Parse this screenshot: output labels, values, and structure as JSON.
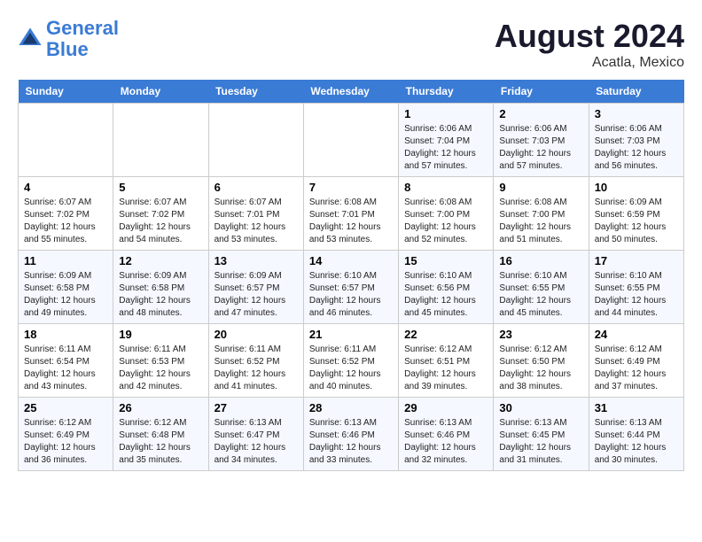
{
  "header": {
    "logo_line1": "General",
    "logo_line2": "Blue",
    "month_year": "August 2024",
    "location": "Acatla, Mexico"
  },
  "days_of_week": [
    "Sunday",
    "Monday",
    "Tuesday",
    "Wednesday",
    "Thursday",
    "Friday",
    "Saturday"
  ],
  "weeks": [
    [
      {
        "day": "",
        "sunrise": "",
        "sunset": "",
        "daylight": ""
      },
      {
        "day": "",
        "sunrise": "",
        "sunset": "",
        "daylight": ""
      },
      {
        "day": "",
        "sunrise": "",
        "sunset": "",
        "daylight": ""
      },
      {
        "day": "",
        "sunrise": "",
        "sunset": "",
        "daylight": ""
      },
      {
        "day": "1",
        "sunrise": "Sunrise: 6:06 AM",
        "sunset": "Sunset: 7:04 PM",
        "daylight": "Daylight: 12 hours and 57 minutes."
      },
      {
        "day": "2",
        "sunrise": "Sunrise: 6:06 AM",
        "sunset": "Sunset: 7:03 PM",
        "daylight": "Daylight: 12 hours and 57 minutes."
      },
      {
        "day": "3",
        "sunrise": "Sunrise: 6:06 AM",
        "sunset": "Sunset: 7:03 PM",
        "daylight": "Daylight: 12 hours and 56 minutes."
      }
    ],
    [
      {
        "day": "4",
        "sunrise": "Sunrise: 6:07 AM",
        "sunset": "Sunset: 7:02 PM",
        "daylight": "Daylight: 12 hours and 55 minutes."
      },
      {
        "day": "5",
        "sunrise": "Sunrise: 6:07 AM",
        "sunset": "Sunset: 7:02 PM",
        "daylight": "Daylight: 12 hours and 54 minutes."
      },
      {
        "day": "6",
        "sunrise": "Sunrise: 6:07 AM",
        "sunset": "Sunset: 7:01 PM",
        "daylight": "Daylight: 12 hours and 53 minutes."
      },
      {
        "day": "7",
        "sunrise": "Sunrise: 6:08 AM",
        "sunset": "Sunset: 7:01 PM",
        "daylight": "Daylight: 12 hours and 53 minutes."
      },
      {
        "day": "8",
        "sunrise": "Sunrise: 6:08 AM",
        "sunset": "Sunset: 7:00 PM",
        "daylight": "Daylight: 12 hours and 52 minutes."
      },
      {
        "day": "9",
        "sunrise": "Sunrise: 6:08 AM",
        "sunset": "Sunset: 7:00 PM",
        "daylight": "Daylight: 12 hours and 51 minutes."
      },
      {
        "day": "10",
        "sunrise": "Sunrise: 6:09 AM",
        "sunset": "Sunset: 6:59 PM",
        "daylight": "Daylight: 12 hours and 50 minutes."
      }
    ],
    [
      {
        "day": "11",
        "sunrise": "Sunrise: 6:09 AM",
        "sunset": "Sunset: 6:58 PM",
        "daylight": "Daylight: 12 hours and 49 minutes."
      },
      {
        "day": "12",
        "sunrise": "Sunrise: 6:09 AM",
        "sunset": "Sunset: 6:58 PM",
        "daylight": "Daylight: 12 hours and 48 minutes."
      },
      {
        "day": "13",
        "sunrise": "Sunrise: 6:09 AM",
        "sunset": "Sunset: 6:57 PM",
        "daylight": "Daylight: 12 hours and 47 minutes."
      },
      {
        "day": "14",
        "sunrise": "Sunrise: 6:10 AM",
        "sunset": "Sunset: 6:57 PM",
        "daylight": "Daylight: 12 hours and 46 minutes."
      },
      {
        "day": "15",
        "sunrise": "Sunrise: 6:10 AM",
        "sunset": "Sunset: 6:56 PM",
        "daylight": "Daylight: 12 hours and 45 minutes."
      },
      {
        "day": "16",
        "sunrise": "Sunrise: 6:10 AM",
        "sunset": "Sunset: 6:55 PM",
        "daylight": "Daylight: 12 hours and 45 minutes."
      },
      {
        "day": "17",
        "sunrise": "Sunrise: 6:10 AM",
        "sunset": "Sunset: 6:55 PM",
        "daylight": "Daylight: 12 hours and 44 minutes."
      }
    ],
    [
      {
        "day": "18",
        "sunrise": "Sunrise: 6:11 AM",
        "sunset": "Sunset: 6:54 PM",
        "daylight": "Daylight: 12 hours and 43 minutes."
      },
      {
        "day": "19",
        "sunrise": "Sunrise: 6:11 AM",
        "sunset": "Sunset: 6:53 PM",
        "daylight": "Daylight: 12 hours and 42 minutes."
      },
      {
        "day": "20",
        "sunrise": "Sunrise: 6:11 AM",
        "sunset": "Sunset: 6:52 PM",
        "daylight": "Daylight: 12 hours and 41 minutes."
      },
      {
        "day": "21",
        "sunrise": "Sunrise: 6:11 AM",
        "sunset": "Sunset: 6:52 PM",
        "daylight": "Daylight: 12 hours and 40 minutes."
      },
      {
        "day": "22",
        "sunrise": "Sunrise: 6:12 AM",
        "sunset": "Sunset: 6:51 PM",
        "daylight": "Daylight: 12 hours and 39 minutes."
      },
      {
        "day": "23",
        "sunrise": "Sunrise: 6:12 AM",
        "sunset": "Sunset: 6:50 PM",
        "daylight": "Daylight: 12 hours and 38 minutes."
      },
      {
        "day": "24",
        "sunrise": "Sunrise: 6:12 AM",
        "sunset": "Sunset: 6:49 PM",
        "daylight": "Daylight: 12 hours and 37 minutes."
      }
    ],
    [
      {
        "day": "25",
        "sunrise": "Sunrise: 6:12 AM",
        "sunset": "Sunset: 6:49 PM",
        "daylight": "Daylight: 12 hours and 36 minutes."
      },
      {
        "day": "26",
        "sunrise": "Sunrise: 6:12 AM",
        "sunset": "Sunset: 6:48 PM",
        "daylight": "Daylight: 12 hours and 35 minutes."
      },
      {
        "day": "27",
        "sunrise": "Sunrise: 6:13 AM",
        "sunset": "Sunset: 6:47 PM",
        "daylight": "Daylight: 12 hours and 34 minutes."
      },
      {
        "day": "28",
        "sunrise": "Sunrise: 6:13 AM",
        "sunset": "Sunset: 6:46 PM",
        "daylight": "Daylight: 12 hours and 33 minutes."
      },
      {
        "day": "29",
        "sunrise": "Sunrise: 6:13 AM",
        "sunset": "Sunset: 6:46 PM",
        "daylight": "Daylight: 12 hours and 32 minutes."
      },
      {
        "day": "30",
        "sunrise": "Sunrise: 6:13 AM",
        "sunset": "Sunset: 6:45 PM",
        "daylight": "Daylight: 12 hours and 31 minutes."
      },
      {
        "day": "31",
        "sunrise": "Sunrise: 6:13 AM",
        "sunset": "Sunset: 6:44 PM",
        "daylight": "Daylight: 12 hours and 30 minutes."
      }
    ]
  ]
}
